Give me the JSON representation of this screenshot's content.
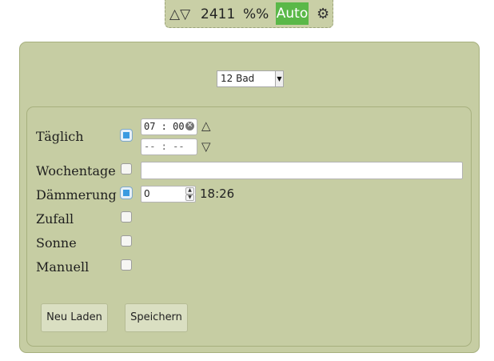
{
  "topbar": {
    "arrows": "△▽",
    "count": "2411",
    "percent": "%%",
    "mode": "Auto",
    "gear": "⚙"
  },
  "device_select": {
    "value": "12 Bad"
  },
  "rows": {
    "daily": {
      "label": "Täglich",
      "checked": true,
      "time_start": "07 : 00",
      "time_end": "-- : --",
      "up_arrow": "△",
      "down_arrow": "▽"
    },
    "weekdays": {
      "label": "Wochentage",
      "checked": false,
      "value": ""
    },
    "dusk": {
      "label": "Dämmerung",
      "checked": true,
      "offset": "0",
      "time": "18:26"
    },
    "random": {
      "label": "Zufall",
      "checked": false
    },
    "sun": {
      "label": "Sonne",
      "checked": false
    },
    "manual": {
      "label": "Manuell",
      "checked": false
    }
  },
  "buttons": {
    "reload": "Neu Laden",
    "save": "Speichern"
  },
  "colors": {
    "panel": "#c6cda3",
    "active_green": "#5ab848",
    "checkbox_blue": "#3a9be0"
  }
}
